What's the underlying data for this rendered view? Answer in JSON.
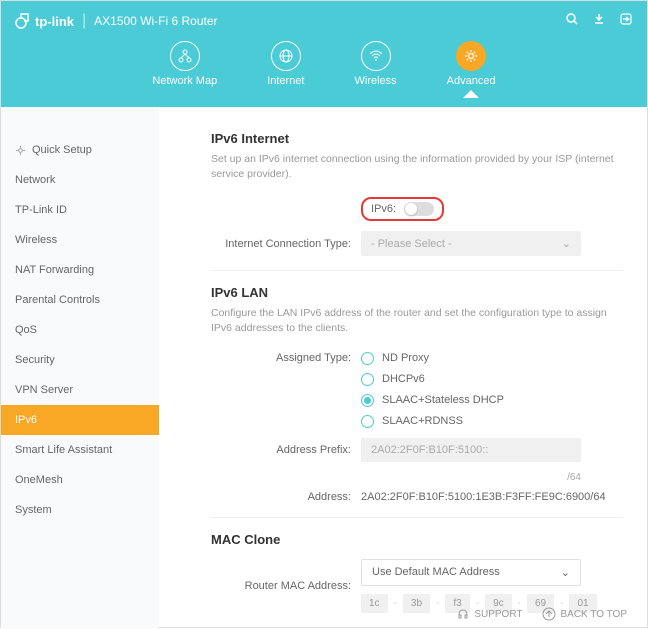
{
  "header": {
    "brand": "tp-link",
    "product": "AX1500 Wi-Fi 6 Router",
    "tabs": [
      {
        "label": "Network Map"
      },
      {
        "label": "Internet"
      },
      {
        "label": "Wireless"
      },
      {
        "label": "Advanced"
      }
    ]
  },
  "sidebar": {
    "items": [
      {
        "label": "Quick Setup"
      },
      {
        "label": "Network"
      },
      {
        "label": "TP-Link ID"
      },
      {
        "label": "Wireless"
      },
      {
        "label": "NAT Forwarding"
      },
      {
        "label": "Parental Controls"
      },
      {
        "label": "QoS"
      },
      {
        "label": "Security"
      },
      {
        "label": "VPN Server"
      },
      {
        "label": "IPv6"
      },
      {
        "label": "Smart Life Assistant"
      },
      {
        "label": "OneMesh"
      },
      {
        "label": "System"
      }
    ],
    "active_index": 9
  },
  "ipv6_internet": {
    "title": "IPv6 Internet",
    "desc": "Set up an IPv6 internet connection using the information provided by your ISP (internet service provider).",
    "toggle_label": "IPv6:",
    "toggle_on": false,
    "conn_type_label": "Internet Connection Type:",
    "conn_type_value": "- Please Select -"
  },
  "ipv6_lan": {
    "title": "IPv6 LAN",
    "desc": "Configure the LAN IPv6 address of the router and set the configuration type to assign IPv6 addresses to the clients.",
    "assigned_type_label": "Assigned Type:",
    "options": [
      {
        "label": "ND Proxy",
        "checked": false
      },
      {
        "label": "DHCPv6",
        "checked": false
      },
      {
        "label": "SLAAC+Stateless DHCP",
        "checked": true
      },
      {
        "label": "SLAAC+RDNSS",
        "checked": false
      }
    ],
    "prefix_label": "Address Prefix:",
    "prefix_value": "2A02:2F0F:B10F:5100::",
    "prefix_suffix": "/64",
    "address_label": "Address:",
    "address_value": "2A02:2F0F:B10F:5100:1E3B:F3FF:FE9C:6900/64"
  },
  "mac_clone": {
    "title": "MAC Clone",
    "mac_label": "Router MAC Address:",
    "mac_select": "Use Default MAC Address",
    "mac_segments": [
      "1c",
      "3b",
      "f3",
      "9c",
      "69",
      "01"
    ]
  },
  "footer": {
    "support": "SUPPORT",
    "back_to_top": "BACK TO TOP"
  }
}
